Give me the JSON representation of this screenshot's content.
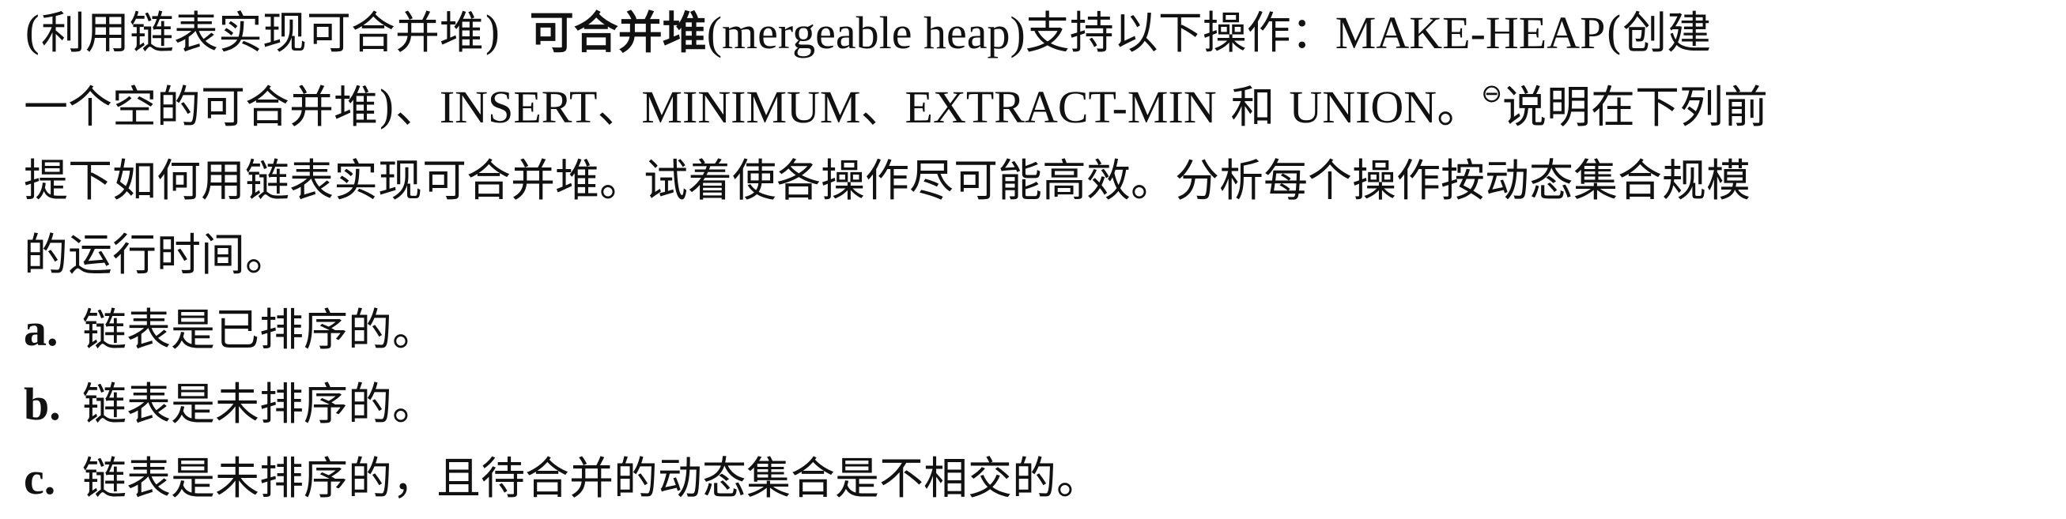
{
  "problem": {
    "tag": "(利用链表实现可合并堆)",
    "term_zh": "可合并堆",
    "term_en": "(mergeable heap)",
    "line1_rest_a": "支持以下操作：",
    "line1_op_make": "MAKE-HEAP",
    "line1_rest_b": "(创建",
    "line2_a": "一个空的可合并堆)、",
    "line2_insert": "INSERT",
    "line2_sep1": "、",
    "line2_minimum": "MINIMUM",
    "line2_sep2": "、",
    "line2_extract": "EXTRACT-MIN",
    "line2_and": " 和 ",
    "line2_union": "UNION",
    "line2_period": "。",
    "footnote_mark": "⊖",
    "line2_b": "说明在下列前",
    "line3": "提下如何用链表实现可合并堆。试着使各操作尽可能高效。分析每个操作按动态集合规模",
    "line4": "的运行时间。"
  },
  "items": [
    {
      "label": "a.",
      "text": "链表是已排序的。"
    },
    {
      "label": "b.",
      "text": "链表是未排序的。"
    },
    {
      "label": "c.",
      "text": "链表是未排序的，且待合并的动态集合是不相交的。"
    }
  ]
}
